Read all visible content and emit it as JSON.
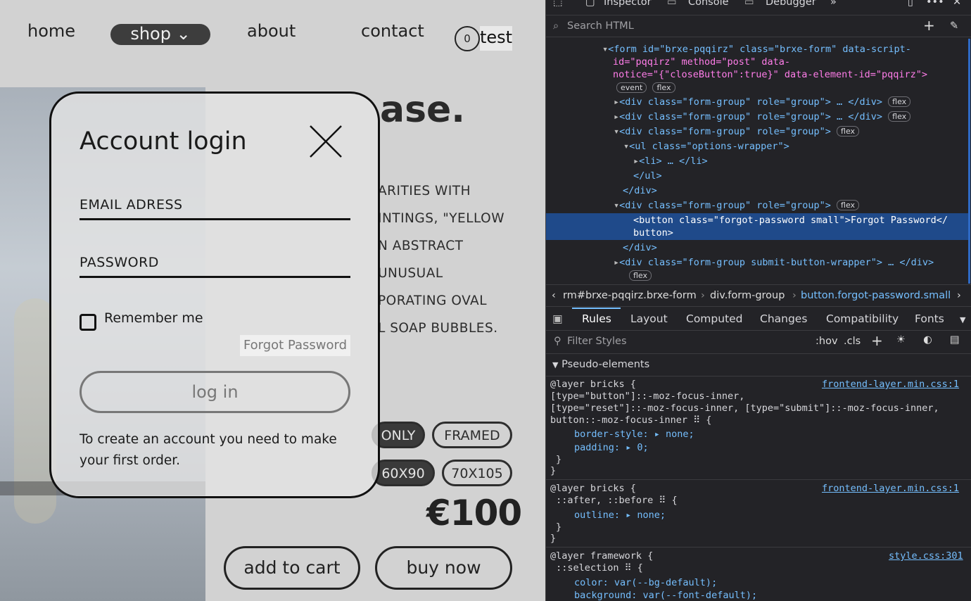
{
  "nav": {
    "home": "home",
    "shop": "shop ⌄",
    "about": "about",
    "contact": "contact",
    "cart_count": "0",
    "test": "test"
  },
  "product": {
    "headline_fragment": "ase.",
    "description_fragments": [
      "ARITIES WITH",
      "INTINGS, \"YELLOW",
      "N ABSTRACT",
      "UNUSUAL",
      "PORATING OVAL",
      "L SOAP BUBBLES."
    ],
    "format_options": [
      "ONLY",
      "FRAMED"
    ],
    "size_options": [
      "60X90",
      "70X105"
    ],
    "price": "€100",
    "add_to_cart": "add to cart",
    "buy_now": "buy now"
  },
  "modal": {
    "title": "Account login",
    "email_label": "EMAIL ADRESS",
    "password_label": "PASSWORD",
    "remember_label": "Remember me",
    "forgot_label": "Forgot Password",
    "login_label": "log in",
    "note": "To create an account you need to make your first order."
  },
  "devtools": {
    "tabs": [
      "Inspector",
      "Console",
      "Debugger"
    ],
    "search_placeholder": "Search HTML",
    "breadcrumb": [
      "rm#brxe-pqqirz.brxe-form",
      "div.form-group",
      "button.forgot-password.small"
    ],
    "rule_tabs": [
      "Rules",
      "Layout",
      "Computed",
      "Changes",
      "Compatibility",
      "Fonts"
    ],
    "filter_placeholder": "Filter Styles",
    "hov": ":hov",
    "cls": ".cls",
    "pseudo_header": "Pseudo-elements",
    "html_lines": [
      "<form id=\"brxe-pqqirz\" class=\"brxe-form\" data-script-",
      "id=\"pqqirz\" method=\"post\" data-",
      "notice=\"{\"closeButton\":true}\" data-element-id=\"pqqirz\">",
      "<div class=\"form-group\" role=\"group\"> … </div>",
      "<div class=\"form-group\" role=\"group\"> … </div>",
      "<div class=\"form-group\" role=\"group\">",
      "<ul class=\"options-wrapper\">",
      "<li> … </li>",
      "</ul>",
      "</div>",
      "<div class=\"form-group\" role=\"group\">",
      "<button class=\"forgot-password small\">Forgot Password</",
      "button>",
      "</div>",
      "<div class=\"form-group submit-button-wrapper\"> … </div>"
    ],
    "badges": {
      "event": "event",
      "flex": "flex"
    },
    "rules": [
      {
        "layer": "@layer bricks {",
        "source": "frontend-layer.min.css:1",
        "selector": "[type=\"button\"]::-moz-focus-inner,\n[type=\"reset\"]::-moz-focus-inner, [type=\"submit\"]::-moz-focus-inner,\nbutton::-moz-focus-inner ⠿ {",
        "decls": [
          "border-style: ▸ none;",
          "padding: ▸ 0;"
        ]
      },
      {
        "layer": "@layer bricks {",
        "source": "frontend-layer.min.css:1",
        "selector": " ::after, ::before ⠿ {",
        "decls": [
          "outline: ▸ none;"
        ]
      },
      {
        "layer": "@layer framework {",
        "source": "style.css:301",
        "selector": " ::selection ⠿ {",
        "decls": [
          "color: var(--bg-default);",
          "background: var(--font-default);"
        ]
      }
    ]
  }
}
